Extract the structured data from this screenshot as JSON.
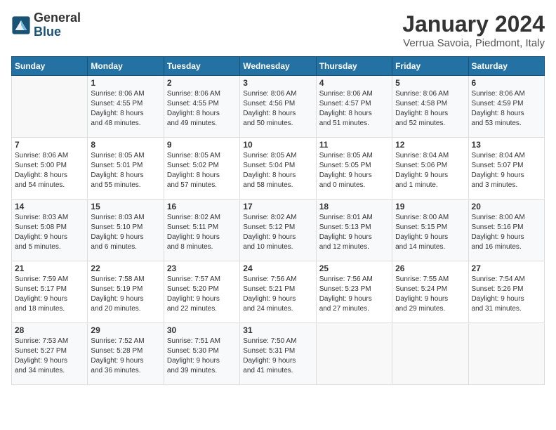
{
  "logo": {
    "general": "General",
    "blue": "Blue"
  },
  "title": "January 2024",
  "location": "Verrua Savoia, Piedmont, Italy",
  "days_of_week": [
    "Sunday",
    "Monday",
    "Tuesday",
    "Wednesday",
    "Thursday",
    "Friday",
    "Saturday"
  ],
  "weeks": [
    [
      {
        "day": "",
        "info": ""
      },
      {
        "day": "1",
        "info": "Sunrise: 8:06 AM\nSunset: 4:55 PM\nDaylight: 8 hours\nand 48 minutes."
      },
      {
        "day": "2",
        "info": "Sunrise: 8:06 AM\nSunset: 4:55 PM\nDaylight: 8 hours\nand 49 minutes."
      },
      {
        "day": "3",
        "info": "Sunrise: 8:06 AM\nSunset: 4:56 PM\nDaylight: 8 hours\nand 50 minutes."
      },
      {
        "day": "4",
        "info": "Sunrise: 8:06 AM\nSunset: 4:57 PM\nDaylight: 8 hours\nand 51 minutes."
      },
      {
        "day": "5",
        "info": "Sunrise: 8:06 AM\nSunset: 4:58 PM\nDaylight: 8 hours\nand 52 minutes."
      },
      {
        "day": "6",
        "info": "Sunrise: 8:06 AM\nSunset: 4:59 PM\nDaylight: 8 hours\nand 53 minutes."
      }
    ],
    [
      {
        "day": "7",
        "info": "Sunrise: 8:06 AM\nSunset: 5:00 PM\nDaylight: 8 hours\nand 54 minutes."
      },
      {
        "day": "8",
        "info": "Sunrise: 8:05 AM\nSunset: 5:01 PM\nDaylight: 8 hours\nand 55 minutes."
      },
      {
        "day": "9",
        "info": "Sunrise: 8:05 AM\nSunset: 5:02 PM\nDaylight: 8 hours\nand 57 minutes."
      },
      {
        "day": "10",
        "info": "Sunrise: 8:05 AM\nSunset: 5:04 PM\nDaylight: 8 hours\nand 58 minutes."
      },
      {
        "day": "11",
        "info": "Sunrise: 8:05 AM\nSunset: 5:05 PM\nDaylight: 9 hours\nand 0 minutes."
      },
      {
        "day": "12",
        "info": "Sunrise: 8:04 AM\nSunset: 5:06 PM\nDaylight: 9 hours\nand 1 minute."
      },
      {
        "day": "13",
        "info": "Sunrise: 8:04 AM\nSunset: 5:07 PM\nDaylight: 9 hours\nand 3 minutes."
      }
    ],
    [
      {
        "day": "14",
        "info": "Sunrise: 8:03 AM\nSunset: 5:08 PM\nDaylight: 9 hours\nand 5 minutes."
      },
      {
        "day": "15",
        "info": "Sunrise: 8:03 AM\nSunset: 5:10 PM\nDaylight: 9 hours\nand 6 minutes."
      },
      {
        "day": "16",
        "info": "Sunrise: 8:02 AM\nSunset: 5:11 PM\nDaylight: 9 hours\nand 8 minutes."
      },
      {
        "day": "17",
        "info": "Sunrise: 8:02 AM\nSunset: 5:12 PM\nDaylight: 9 hours\nand 10 minutes."
      },
      {
        "day": "18",
        "info": "Sunrise: 8:01 AM\nSunset: 5:13 PM\nDaylight: 9 hours\nand 12 minutes."
      },
      {
        "day": "19",
        "info": "Sunrise: 8:00 AM\nSunset: 5:15 PM\nDaylight: 9 hours\nand 14 minutes."
      },
      {
        "day": "20",
        "info": "Sunrise: 8:00 AM\nSunset: 5:16 PM\nDaylight: 9 hours\nand 16 minutes."
      }
    ],
    [
      {
        "day": "21",
        "info": "Sunrise: 7:59 AM\nSunset: 5:17 PM\nDaylight: 9 hours\nand 18 minutes."
      },
      {
        "day": "22",
        "info": "Sunrise: 7:58 AM\nSunset: 5:19 PM\nDaylight: 9 hours\nand 20 minutes."
      },
      {
        "day": "23",
        "info": "Sunrise: 7:57 AM\nSunset: 5:20 PM\nDaylight: 9 hours\nand 22 minutes."
      },
      {
        "day": "24",
        "info": "Sunrise: 7:56 AM\nSunset: 5:21 PM\nDaylight: 9 hours\nand 24 minutes."
      },
      {
        "day": "25",
        "info": "Sunrise: 7:56 AM\nSunset: 5:23 PM\nDaylight: 9 hours\nand 27 minutes."
      },
      {
        "day": "26",
        "info": "Sunrise: 7:55 AM\nSunset: 5:24 PM\nDaylight: 9 hours\nand 29 minutes."
      },
      {
        "day": "27",
        "info": "Sunrise: 7:54 AM\nSunset: 5:26 PM\nDaylight: 9 hours\nand 31 minutes."
      }
    ],
    [
      {
        "day": "28",
        "info": "Sunrise: 7:53 AM\nSunset: 5:27 PM\nDaylight: 9 hours\nand 34 minutes."
      },
      {
        "day": "29",
        "info": "Sunrise: 7:52 AM\nSunset: 5:28 PM\nDaylight: 9 hours\nand 36 minutes."
      },
      {
        "day": "30",
        "info": "Sunrise: 7:51 AM\nSunset: 5:30 PM\nDaylight: 9 hours\nand 39 minutes."
      },
      {
        "day": "31",
        "info": "Sunrise: 7:50 AM\nSunset: 5:31 PM\nDaylight: 9 hours\nand 41 minutes."
      },
      {
        "day": "",
        "info": ""
      },
      {
        "day": "",
        "info": ""
      },
      {
        "day": "",
        "info": ""
      }
    ]
  ]
}
